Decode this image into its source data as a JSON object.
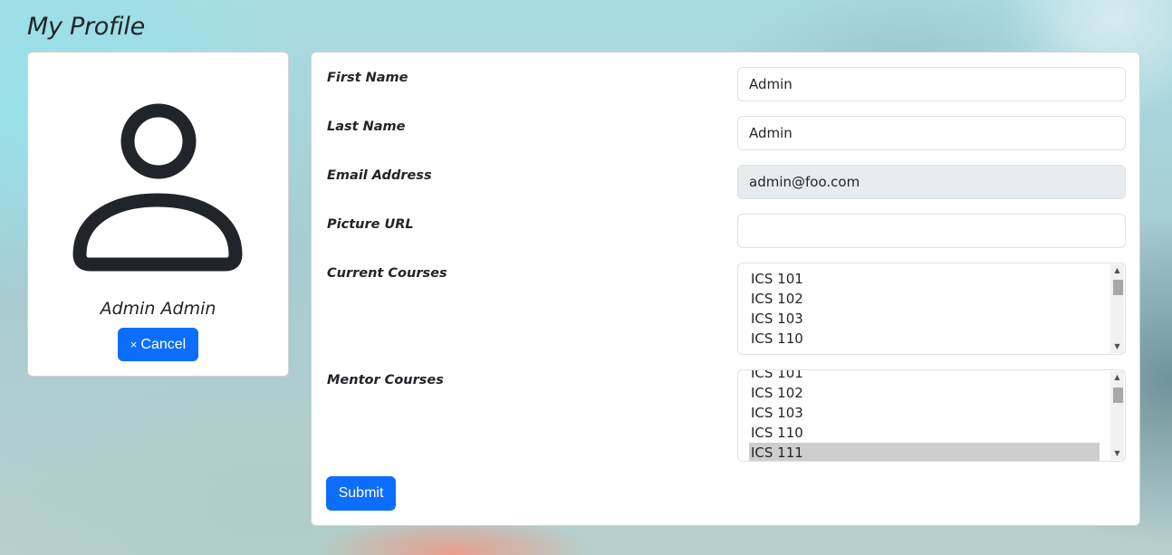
{
  "page": {
    "title": "My Profile"
  },
  "profile": {
    "avatar_icon": "person-icon",
    "name": "Admin Admin",
    "cancel_icon": "close-icon",
    "cancel_glyph": "×",
    "cancel_label": "Cancel"
  },
  "form": {
    "first_name": {
      "label": "First Name",
      "value": "Admin"
    },
    "last_name": {
      "label": "Last Name",
      "value": "Admin"
    },
    "email": {
      "label": "Email Address",
      "value": "admin@foo.com"
    },
    "picture_url": {
      "label": "Picture URL",
      "value": ""
    },
    "current_courses": {
      "label": "Current Courses",
      "options": [
        "ICS 101",
        "ICS 102",
        "ICS 103",
        "ICS 110"
      ]
    },
    "mentor_courses": {
      "label": "Mentor Courses",
      "options": [
        "ICS 101",
        "ICS 102",
        "ICS 103",
        "ICS 110",
        "ICS 111"
      ],
      "selected": "ICS 111"
    },
    "submit_label": "Submit"
  },
  "colors": {
    "primary": "#0d6efd",
    "disabled_input": "#e9ecef",
    "selected_option": "#cecece",
    "text": "#212529"
  }
}
